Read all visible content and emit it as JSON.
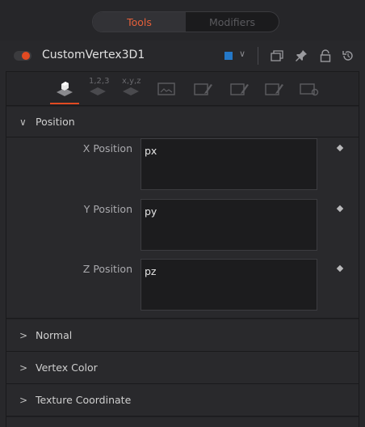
{
  "mode_switch": {
    "tabs": [
      "Tools",
      "Modifiers"
    ],
    "active": "Tools"
  },
  "node": {
    "name": "CustomVertex3D1",
    "color_swatch": "#2478c8",
    "accent": "#e14a22"
  },
  "toolbar": {
    "tabs": [
      {
        "icon": "controls-tab-icon",
        "active": true
      },
      {
        "text": "1,2,3"
      },
      {
        "text": "x,y,z"
      },
      {
        "icon": "image-tab-icon"
      },
      {
        "icon": "edit-tab-icon"
      },
      {
        "icon": "edit-tab-icon"
      },
      {
        "icon": "edit-tab-icon"
      },
      {
        "icon": "settings-tab-icon"
      }
    ]
  },
  "sections": {
    "position": {
      "label": "Position",
      "expanded": true,
      "fields": [
        {
          "label": "X Position",
          "value": "px"
        },
        {
          "label": "Y Position",
          "value": "py"
        },
        {
          "label": "Z Position",
          "value": "pz"
        }
      ]
    },
    "normal": {
      "label": "Normal"
    },
    "vertex_color": {
      "label": "Vertex Color"
    },
    "texture_coordinate": {
      "label": "Texture Coordinate"
    }
  }
}
